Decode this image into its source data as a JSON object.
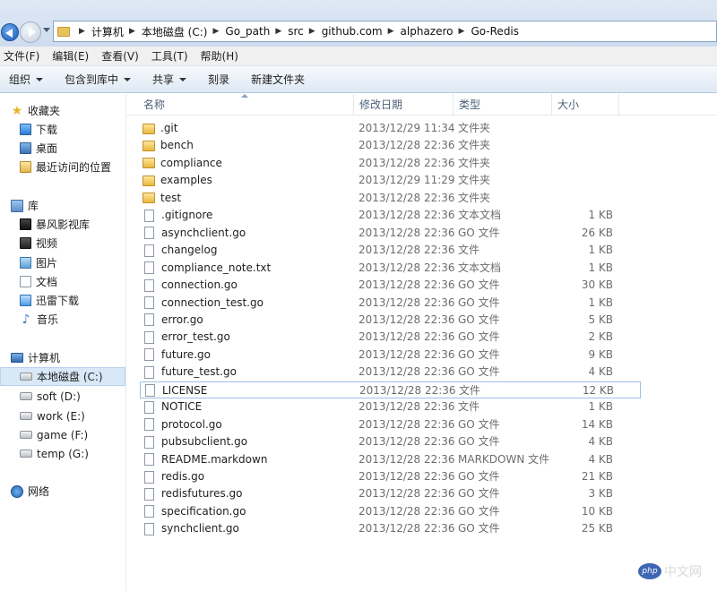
{
  "breadcrumb": [
    "计算机",
    "本地磁盘 (C:)",
    "Go_path",
    "src",
    "github.com",
    "alphazero",
    "Go-Redis"
  ],
  "menu": [
    "文件(F)",
    "编辑(E)",
    "查看(V)",
    "工具(T)",
    "帮助(H)"
  ],
  "commands": [
    {
      "label": "组织",
      "dropdown": true
    },
    {
      "label": "包含到库中",
      "dropdown": true
    },
    {
      "label": "共享",
      "dropdown": true
    },
    {
      "label": "刻录",
      "dropdown": false
    },
    {
      "label": "新建文件夹",
      "dropdown": false
    }
  ],
  "nav": {
    "favorites": {
      "label": "收藏夹",
      "items": [
        "下载",
        "桌面",
        "最近访问的位置"
      ]
    },
    "libraries": {
      "label": "库",
      "items": [
        "暴风影视库",
        "视频",
        "图片",
        "文档",
        "迅雷下载",
        "音乐"
      ]
    },
    "computer": {
      "label": "计算机",
      "items": [
        "本地磁盘 (C:)",
        "soft (D:)",
        "work (E:)",
        "game (F:)",
        "temp (G:)"
      ]
    },
    "network": {
      "label": "网络"
    }
  },
  "columns": {
    "name": "名称",
    "date": "修改日期",
    "type": "类型",
    "size": "大小"
  },
  "files": [
    {
      "name": ".git",
      "date": "2013/12/29 11:34",
      "type": "文件夹",
      "size": "",
      "kind": "folder"
    },
    {
      "name": "bench",
      "date": "2013/12/28 22:36",
      "type": "文件夹",
      "size": "",
      "kind": "folder"
    },
    {
      "name": "compliance",
      "date": "2013/12/28 22:36",
      "type": "文件夹",
      "size": "",
      "kind": "folder"
    },
    {
      "name": "examples",
      "date": "2013/12/29 11:29",
      "type": "文件夹",
      "size": "",
      "kind": "folder"
    },
    {
      "name": "test",
      "date": "2013/12/28 22:36",
      "type": "文件夹",
      "size": "",
      "kind": "folder"
    },
    {
      "name": ".gitignore",
      "date": "2013/12/28 22:36",
      "type": "文本文档",
      "size": "1 KB",
      "kind": "file"
    },
    {
      "name": "asynchclient.go",
      "date": "2013/12/28 22:36",
      "type": "GO 文件",
      "size": "26 KB",
      "kind": "file"
    },
    {
      "name": "changelog",
      "date": "2013/12/28 22:36",
      "type": "文件",
      "size": "1 KB",
      "kind": "file"
    },
    {
      "name": "compliance_note.txt",
      "date": "2013/12/28 22:36",
      "type": "文本文档",
      "size": "1 KB",
      "kind": "file"
    },
    {
      "name": "connection.go",
      "date": "2013/12/28 22:36",
      "type": "GO 文件",
      "size": "30 KB",
      "kind": "file"
    },
    {
      "name": "connection_test.go",
      "date": "2013/12/28 22:36",
      "type": "GO 文件",
      "size": "1 KB",
      "kind": "file"
    },
    {
      "name": "error.go",
      "date": "2013/12/28 22:36",
      "type": "GO 文件",
      "size": "5 KB",
      "kind": "file"
    },
    {
      "name": "error_test.go",
      "date": "2013/12/28 22:36",
      "type": "GO 文件",
      "size": "2 KB",
      "kind": "file"
    },
    {
      "name": "future.go",
      "date": "2013/12/28 22:36",
      "type": "GO 文件",
      "size": "9 KB",
      "kind": "file"
    },
    {
      "name": "future_test.go",
      "date": "2013/12/28 22:36",
      "type": "GO 文件",
      "size": "4 KB",
      "kind": "file"
    },
    {
      "name": "LICENSE",
      "date": "2013/12/28 22:36",
      "type": "文件",
      "size": "12 KB",
      "kind": "file",
      "selected": true
    },
    {
      "name": "NOTICE",
      "date": "2013/12/28 22:36",
      "type": "文件",
      "size": "1 KB",
      "kind": "file"
    },
    {
      "name": "protocol.go",
      "date": "2013/12/28 22:36",
      "type": "GO 文件",
      "size": "14 KB",
      "kind": "file"
    },
    {
      "name": "pubsubclient.go",
      "date": "2013/12/28 22:36",
      "type": "GO 文件",
      "size": "4 KB",
      "kind": "file"
    },
    {
      "name": "README.markdown",
      "date": "2013/12/28 22:36",
      "type": "MARKDOWN 文件",
      "size": "4 KB",
      "kind": "file"
    },
    {
      "name": "redis.go",
      "date": "2013/12/28 22:36",
      "type": "GO 文件",
      "size": "21 KB",
      "kind": "file"
    },
    {
      "name": "redisfutures.go",
      "date": "2013/12/28 22:36",
      "type": "GO 文件",
      "size": "3 KB",
      "kind": "file"
    },
    {
      "name": "specification.go",
      "date": "2013/12/28 22:36",
      "type": "GO 文件",
      "size": "10 KB",
      "kind": "file"
    },
    {
      "name": "synchclient.go",
      "date": "2013/12/28 22:36",
      "type": "GO 文件",
      "size": "25 KB",
      "kind": "file"
    }
  ],
  "watermark": {
    "logo": "php",
    "text": "中文网"
  }
}
